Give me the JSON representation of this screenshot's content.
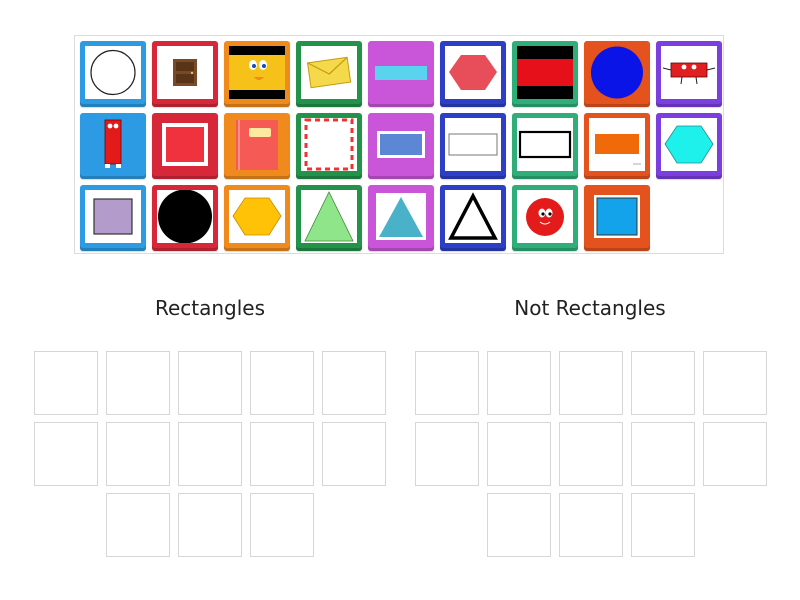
{
  "groups": {
    "left_title": "Rectangles",
    "right_title": "Not Rectangles"
  },
  "colors": {
    "blue": "#2d9be3",
    "red": "#d7283a",
    "orange": "#f08a1d",
    "green": "#23924a",
    "magenta": "#c955d8",
    "navy": "#2c3fc6",
    "teal": "#2fae7a",
    "orangered": "#e4521e",
    "purple": "#7b3fe0"
  },
  "tiles": [
    {
      "frame": "blue",
      "item": "white-circle"
    },
    {
      "frame": "red",
      "item": "door"
    },
    {
      "frame": "orange",
      "item": "yellow-face"
    },
    {
      "frame": "green",
      "item": "envelope"
    },
    {
      "frame": "magenta",
      "item": "cyan-bar"
    },
    {
      "frame": "navy",
      "item": "red-hexagon"
    },
    {
      "frame": "teal",
      "item": "red-black-rectangle"
    },
    {
      "frame": "orangered",
      "item": "blue-circle"
    },
    {
      "frame": "purple",
      "item": "red-character"
    },
    {
      "frame": "blue",
      "item": "red-tall-character"
    },
    {
      "frame": "red",
      "item": "red-square"
    },
    {
      "frame": "orange",
      "item": "notebook"
    },
    {
      "frame": "green",
      "item": "picture-frame"
    },
    {
      "frame": "magenta",
      "item": "blue-rectangle"
    },
    {
      "frame": "navy",
      "item": "white-rectangle"
    },
    {
      "frame": "teal",
      "item": "outlined-rectangle"
    },
    {
      "frame": "orangered",
      "item": "orange-rectangle"
    },
    {
      "frame": "purple",
      "item": "cyan-hexagon"
    },
    {
      "frame": "blue",
      "item": "purple-square"
    },
    {
      "frame": "red",
      "item": "black-circle"
    },
    {
      "frame": "orange",
      "item": "yellow-hexagon"
    },
    {
      "frame": "green",
      "item": "green-triangle"
    },
    {
      "frame": "magenta",
      "item": "teal-triangle"
    },
    {
      "frame": "navy",
      "item": "white-triangle"
    },
    {
      "frame": "teal",
      "item": "red-ball-face"
    },
    {
      "frame": "orangered",
      "item": "blue-square"
    }
  ]
}
